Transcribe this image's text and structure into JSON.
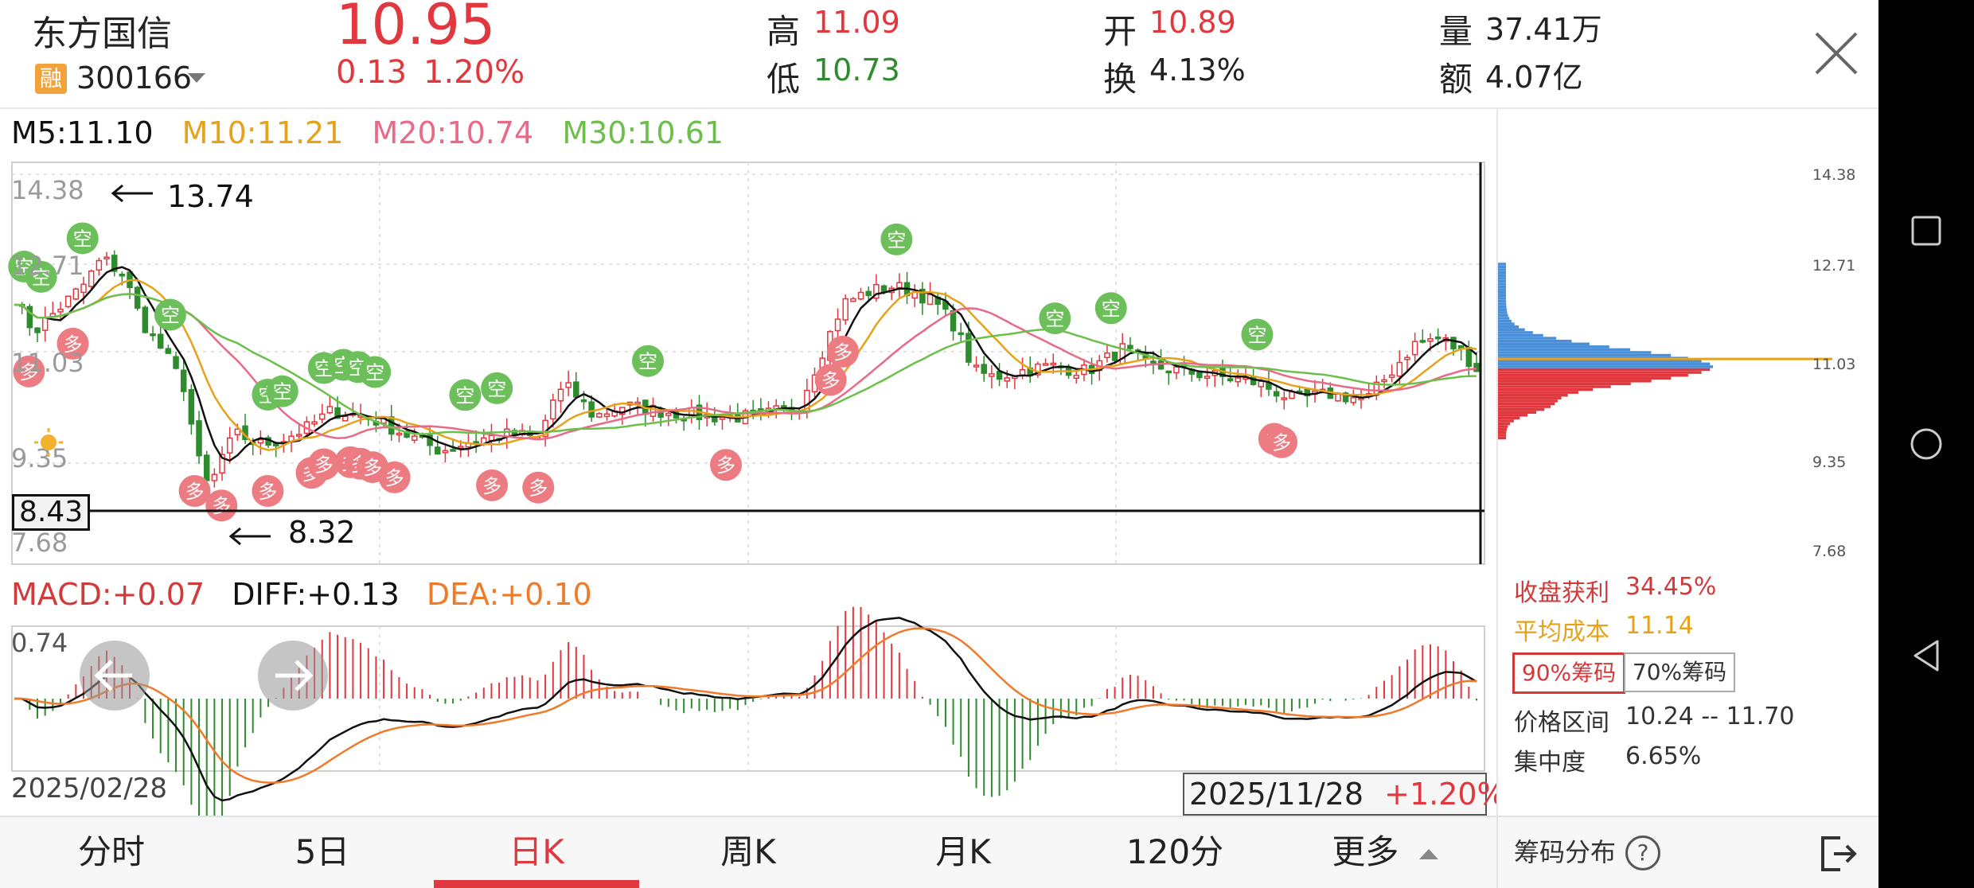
{
  "header": {
    "name": "东方国信",
    "code": "300166",
    "margin_badge": "融",
    "price": "10.95",
    "change": "0.13",
    "change_pct": "1.20%",
    "high_label": "高",
    "high": "11.09",
    "low_label": "低",
    "low": "10.73",
    "open_label": "开",
    "open": "10.89",
    "turnover_label": "换",
    "turnover": "4.13%",
    "volume_label": "量",
    "volume": "37.41万",
    "amount_label": "额",
    "amount": "4.07亿"
  },
  "ma_legend": {
    "m5": "M5:11.10",
    "m10": "M10:11.21",
    "m20": "M20:10.74",
    "m30": "M30:10.61"
  },
  "macd_legend": {
    "macd": "MACD:+0.07",
    "diff": "DIFF:+0.13",
    "dea": "DEA:+0.10"
  },
  "kline": {
    "y_ticks": [
      "14.38",
      "12.71",
      "11.03",
      "9.35",
      "7.68"
    ],
    "max_label": "13.74",
    "min_label": "8.32",
    "crosshair_label": "8.43",
    "macd_top_tick": "0.74",
    "start_date": "2025/02/28",
    "end_date": "2025/11/28",
    "end_change": "+1.20%",
    "short_signal": "空",
    "long_signal": "多"
  },
  "chip_panel": {
    "y_ticks": [
      "14.38",
      "12.71",
      "11.03",
      "9.35",
      "7.68"
    ],
    "profit_label": "收盘获利",
    "profit": "34.45%",
    "avg_cost_label": "平均成本",
    "avg_cost": "11.14",
    "btn_90": "90%筹码",
    "btn_70": "70%筹码",
    "range_label": "价格区间",
    "range": "10.24 -- 11.70",
    "concentration_label": "集中度",
    "concentration": "6.65%",
    "footer_label": "筹码分布",
    "help": "?"
  },
  "tabs": [
    "分时",
    "5日",
    "日K",
    "周K",
    "月K",
    "120分",
    "更多"
  ],
  "active_tab": "日K",
  "colors": {
    "up": "#e0383e",
    "down": "#2e8b2e",
    "m5": "#111111",
    "m10": "#e6a21a",
    "m20": "#e86a86",
    "m30": "#6cbf4a",
    "dea": "#f07a2a",
    "chip_blue": "#4a90d9",
    "chip_red": "#e0383e"
  },
  "chart_data": {
    "type": "candlestick",
    "x_range": [
      "2025/02/28",
      "2025/11/28"
    ],
    "y_axis_ticks": [
      14.38,
      12.71,
      11.03,
      9.35,
      7.68
    ],
    "ylim": [
      7.68,
      14.38
    ],
    "period_high": 13.74,
    "period_low": 8.32,
    "last_close": 10.95,
    "moving_averages": {
      "M5": 11.1,
      "M10": 11.21,
      "M20": 10.74,
      "M30": 10.61
    },
    "close_path": [
      [
        0,
        12.2
      ],
      [
        8,
        11.6
      ],
      [
        18,
        12.0
      ],
      [
        28,
        12.4
      ],
      [
        36,
        12.9
      ],
      [
        45,
        12.6
      ],
      [
        52,
        11.8
      ],
      [
        62,
        11.2
      ],
      [
        70,
        10.6
      ],
      [
        75,
        9.4
      ],
      [
        80,
        8.8
      ],
      [
        86,
        9.5
      ],
      [
        92,
        9.8
      ],
      [
        100,
        9.6
      ],
      [
        110,
        9.7
      ],
      [
        120,
        9.9
      ],
      [
        130,
        10.2
      ],
      [
        145,
        10.1
      ],
      [
        160,
        9.8
      ],
      [
        175,
        9.5
      ],
      [
        190,
        9.7
      ],
      [
        205,
        9.8
      ],
      [
        215,
        9.7
      ],
      [
        222,
        10.5
      ],
      [
        228,
        10.6
      ],
      [
        238,
        10.1
      ],
      [
        250,
        10.3
      ],
      [
        265,
        10.2
      ],
      [
        285,
        10.1
      ],
      [
        305,
        10.1
      ],
      [
        322,
        10.3
      ],
      [
        330,
        11.1
      ],
      [
        340,
        12.1
      ],
      [
        350,
        12.3
      ],
      [
        360,
        12.4
      ],
      [
        370,
        12.3
      ],
      [
        378,
        12.1
      ],
      [
        386,
        11.7
      ],
      [
        394,
        10.9
      ],
      [
        402,
        10.8
      ],
      [
        412,
        10.9
      ],
      [
        425,
        11.0
      ],
      [
        440,
        10.9
      ],
      [
        455,
        11.3
      ],
      [
        465,
        11.0
      ],
      [
        480,
        10.9
      ],
      [
        495,
        10.8
      ],
      [
        510,
        10.7
      ],
      [
        525,
        10.4
      ],
      [
        540,
        10.5
      ],
      [
        555,
        10.4
      ],
      [
        565,
        10.9
      ],
      [
        575,
        11.4
      ],
      [
        585,
        11.5
      ],
      [
        595,
        11.2
      ],
      [
        600,
        10.95
      ]
    ],
    "macd": {
      "MACD": 0.07,
      "DIFF": 0.13,
      "DEA": 0.1,
      "top_tick": 0.74
    },
    "chip_distribution": {
      "close_profit_pct": 34.45,
      "avg_cost": 11.14,
      "price_range_90": [
        10.24,
        11.7
      ],
      "concentration_pct": 6.65
    }
  }
}
